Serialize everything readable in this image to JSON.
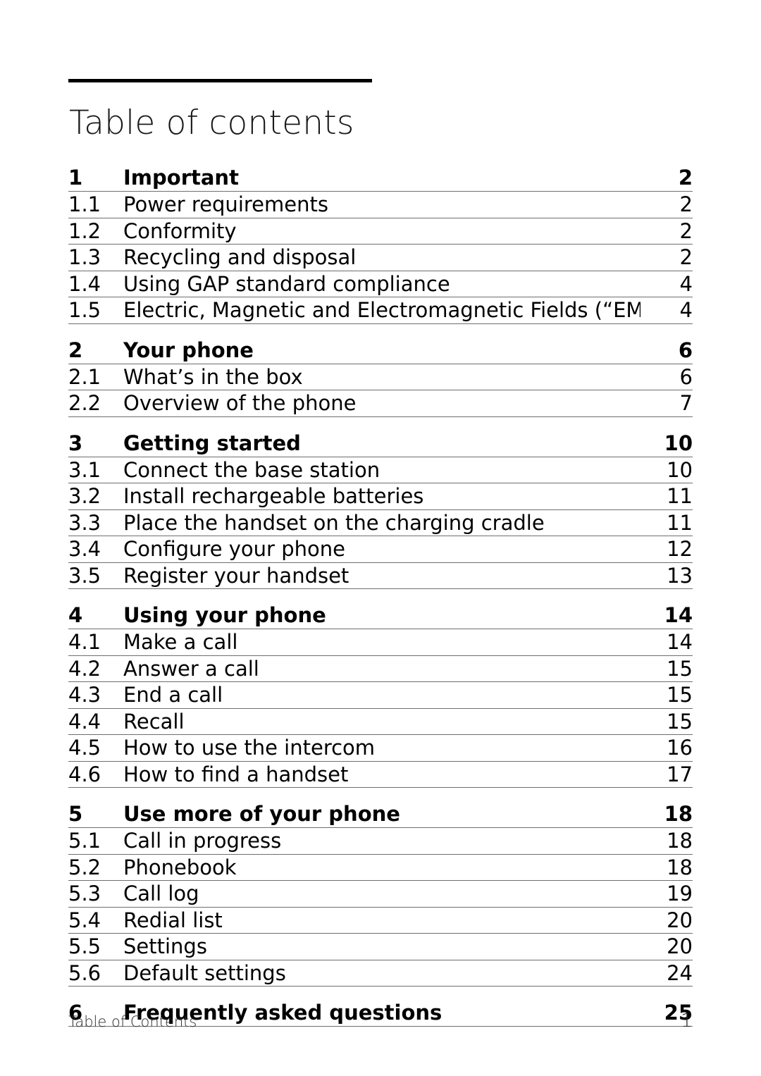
{
  "document": {
    "title": "Table of contents",
    "footer_label": "Table of Contents",
    "footer_page_number": "1"
  },
  "toc": {
    "rows": [
      {
        "kind": "section",
        "number": "1",
        "label": "Important",
        "page": "2"
      },
      {
        "kind": "sub",
        "number": "1.1",
        "label": "Power requirements",
        "page": "2"
      },
      {
        "kind": "sub",
        "number": "1.2",
        "label": "Conformity",
        "page": "2"
      },
      {
        "kind": "sub",
        "number": "1.3",
        "label": "Recycling and disposal",
        "page": "2"
      },
      {
        "kind": "sub",
        "number": "1.4",
        "label": "Using GAP standard compliance",
        "page": "4"
      },
      {
        "kind": "sub",
        "number": "1.5",
        "label": "Electric, Magnetic and Electromagnetic Fields (“EMF”)",
        "page": "4"
      },
      {
        "kind": "section",
        "number": "2",
        "label": "Your phone",
        "page": "6"
      },
      {
        "kind": "sub",
        "number": "2.1",
        "label": "What’s in the box",
        "page": "6"
      },
      {
        "kind": "sub",
        "number": "2.2",
        "label": "Overview of the phone",
        "page": "7"
      },
      {
        "kind": "section",
        "number": "3",
        "label": "Getting started",
        "page": "10"
      },
      {
        "kind": "sub",
        "number": "3.1",
        "label": "Connect the base station",
        "page": "10"
      },
      {
        "kind": "sub",
        "number": "3.2",
        "label": "Install rechargeable batteries",
        "page": "11"
      },
      {
        "kind": "sub",
        "number": "3.3",
        "label": "Place the handset on the charging cradle",
        "page": "11"
      },
      {
        "kind": "sub",
        "number": "3.4",
        "label": "Configure your phone",
        "page": "12"
      },
      {
        "kind": "sub",
        "number": "3.5",
        "label": "Register your handset",
        "page": "13"
      },
      {
        "kind": "section",
        "number": "4",
        "label": "Using your phone",
        "page": "14"
      },
      {
        "kind": "sub",
        "number": "4.1",
        "label": "Make a call",
        "page": "14"
      },
      {
        "kind": "sub",
        "number": "4.2",
        "label": "Answer a call",
        "page": "15"
      },
      {
        "kind": "sub",
        "number": "4.3",
        "label": "End a call",
        "page": "15"
      },
      {
        "kind": "sub",
        "number": "4.4",
        "label": "Recall",
        "page": "15"
      },
      {
        "kind": "sub",
        "number": "4.5",
        "label": "How to use the intercom",
        "page": "16"
      },
      {
        "kind": "sub",
        "number": "4.6",
        "label": "How to find a handset",
        "page": "17"
      },
      {
        "kind": "section",
        "number": "5",
        "label": "Use more of your phone",
        "page": "18"
      },
      {
        "kind": "sub",
        "number": "5.1",
        "label": "Call in progress",
        "page": "18"
      },
      {
        "kind": "sub",
        "number": "5.2",
        "label": "Phonebook",
        "page": "18"
      },
      {
        "kind": "sub",
        "number": "5.3",
        "label": "Call log",
        "page": "19"
      },
      {
        "kind": "sub",
        "number": "5.4",
        "label": "Redial list",
        "page": "20"
      },
      {
        "kind": "sub",
        "number": "5.5",
        "label": "Settings",
        "page": "20"
      },
      {
        "kind": "sub",
        "number": "5.6",
        "label": "Default settings",
        "page": "24"
      },
      {
        "kind": "section",
        "number": "6",
        "label": "Frequently asked questions",
        "page": "25"
      }
    ]
  },
  "style": {
    "rule_color": "#000000",
    "separator_color": "#6e6e6e",
    "text_color": "#000000"
  }
}
